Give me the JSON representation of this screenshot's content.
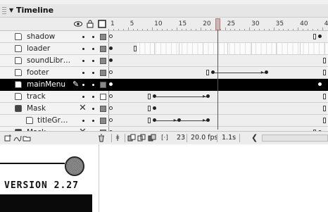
{
  "panel": {
    "title": "Timeline",
    "header_icons": [
      "eye-icon",
      "lock-icon",
      "outline-icon"
    ]
  },
  "ruler": {
    "labels": [
      "1",
      "5",
      "10",
      "15",
      "20",
      "25",
      "30",
      "35",
      "40",
      "45"
    ],
    "current_frame": 23
  },
  "layers": [
    {
      "name": "shadow",
      "icon": "layer-icon",
      "outline": "gray"
    },
    {
      "name": "loader",
      "icon": "layer-icon",
      "outline": "gray"
    },
    {
      "name": "soundLibr…",
      "icon": "layer-icon",
      "outline": "gray"
    },
    {
      "name": "footer",
      "icon": "layer-icon",
      "outline": "gray"
    },
    {
      "name": "mainMenu",
      "icon": "layer-icon",
      "outline": "gray",
      "selected": true
    },
    {
      "name": "track",
      "icon": "layer-icon",
      "outline": "white"
    },
    {
      "name": "Mask",
      "icon": "mask-icon",
      "outline": "gray",
      "hidden": true
    },
    {
      "name": "titleGr…",
      "icon": "masked-layer-icon",
      "outline": "gray",
      "sub": true
    },
    {
      "name": "Mask",
      "icon": "mask-icon",
      "outline": "gray",
      "hidden": true
    }
  ],
  "status": {
    "frame": "23",
    "fps": "20.0 fps",
    "time": "1.1s"
  },
  "stage": {
    "version_text": "VERSION 2.27"
  },
  "colors": {
    "selected_row": "#000000",
    "playhead": "#cc2222",
    "panel_bg": "#f1f1f1"
  }
}
